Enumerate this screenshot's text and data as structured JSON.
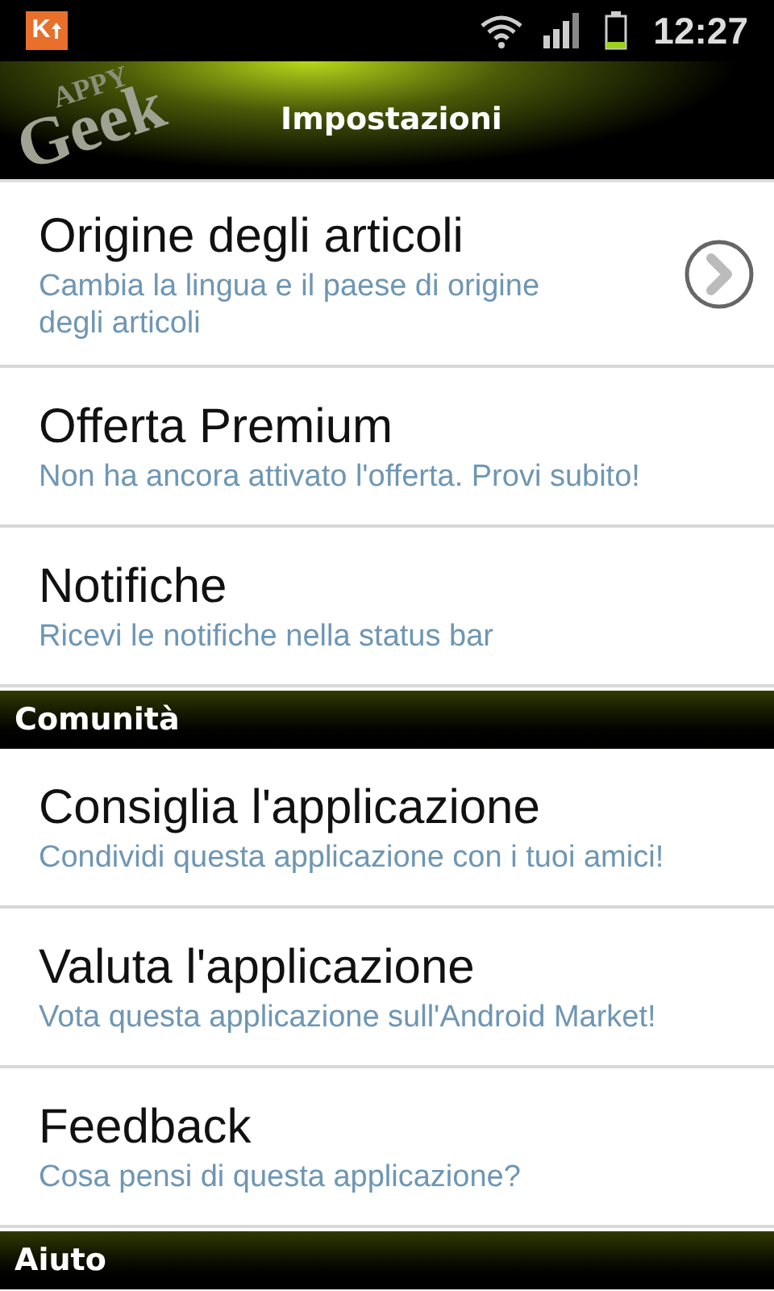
{
  "status_bar": {
    "notification": "K",
    "time": "12:27"
  },
  "header": {
    "logo_top": "APPY",
    "logo_bottom": "Geek",
    "title": "Impostazioni"
  },
  "rows": [
    {
      "kind": "link",
      "title": "Origine degli articoli",
      "summary": "Cambia la lingua e il paese di origine degli articoli"
    },
    {
      "kind": "setting",
      "title": "Offerta Premium",
      "summary": "Non ha ancora attivato l'offerta. Provi subito!"
    },
    {
      "kind": "setting",
      "title": "Notifiche",
      "summary": "Ricevi le notifiche nella status bar"
    },
    {
      "kind": "section",
      "title": "Comunità"
    },
    {
      "kind": "setting",
      "title": "Consiglia l'applicazione",
      "summary": "Condividi questa applicazione con i tuoi amici!"
    },
    {
      "kind": "setting",
      "title": "Valuta l'applicazione",
      "summary": "Vota questa applicazione sull'Android Market!"
    },
    {
      "kind": "setting",
      "title": "Feedback",
      "summary": "Cosa pensi di questa applicazione?"
    },
    {
      "kind": "section",
      "title": "Aiuto"
    }
  ]
}
